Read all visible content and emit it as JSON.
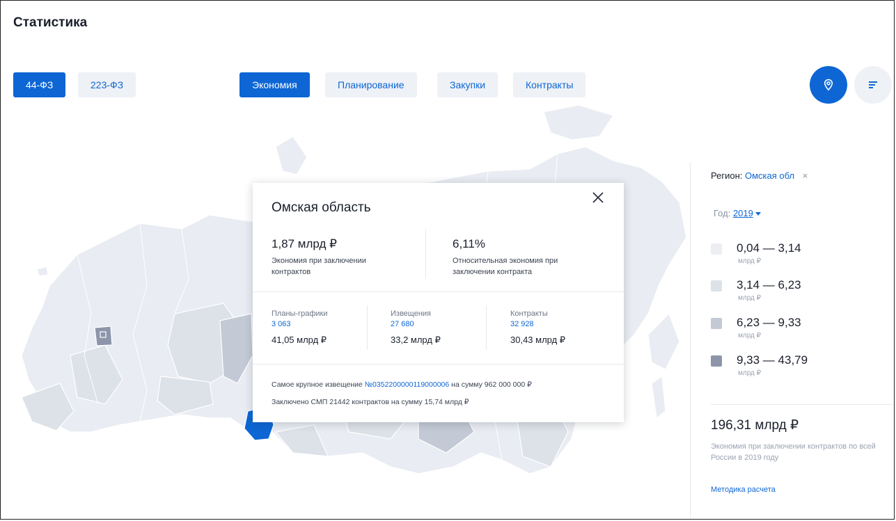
{
  "page": {
    "title": "Статистика"
  },
  "law_tabs": [
    {
      "label": "44-ФЗ",
      "active": true
    },
    {
      "label": "223-ФЗ",
      "active": false
    }
  ],
  "section_tabs": [
    {
      "label": "Экономия",
      "active": true
    },
    {
      "label": "Планирование",
      "active": false
    },
    {
      "label": "Закупки",
      "active": false
    },
    {
      "label": "Контракты",
      "active": false
    }
  ],
  "view_buttons": {
    "map": "map-pin-icon",
    "list": "list-lines-icon"
  },
  "colors": {
    "accent": "#0d66d4",
    "tab_bg": "#eef1f6",
    "map_fill": "#e9ecf2"
  },
  "sidebar": {
    "region_label": "Регион:",
    "region_value": "Омская обл",
    "region_clear": "×",
    "year_label": "Год:",
    "year_value": "2019",
    "legend": [
      {
        "range": "0,04 — 3,14",
        "unit": "млрд ₽",
        "color": "#eceef2"
      },
      {
        "range": "3,14 — 6,23",
        "unit": "млрд ₽",
        "color": "#dde1e8"
      },
      {
        "range": "6,23 — 9,33",
        "unit": "млрд ₽",
        "color": "#c3c9d5"
      },
      {
        "range": "9,33 — 43,79",
        "unit": "млрд ₽",
        "color": "#8c95aa"
      }
    ],
    "total_value": "196,31 млрд ₽",
    "total_description": "Экономия при заключении контрактов по всей России в 2019 году",
    "method_link": "Методика расчета"
  },
  "popup": {
    "title": "Омская область",
    "kpi_left": {
      "value": "1,87 млрд ₽",
      "label": "Экономия при заключении контрактов"
    },
    "kpi_right": {
      "value": "6,11%",
      "label": "Относительная экономия при заключении контракта"
    },
    "stats": [
      {
        "label": "Планы-графики",
        "count": "3 063",
        "amount": "41,05 млрд ₽"
      },
      {
        "label": "Извещения",
        "count": "27 680",
        "amount": "33,2 млрд ₽"
      },
      {
        "label": "Контракты",
        "count": "32 928",
        "amount": "30,43 млрд ₽"
      }
    ],
    "largest_notice": {
      "prefix": "Самое крупное извещение",
      "number": "№0352200000119000006",
      "suffix": "на сумму 962 000 000 ₽"
    },
    "smp": {
      "prefix": "Заключено",
      "smp_label": "СМП",
      "count": "21442",
      "middle": "контрактов на сумму",
      "amount": "15,74 млрд ₽"
    }
  }
}
